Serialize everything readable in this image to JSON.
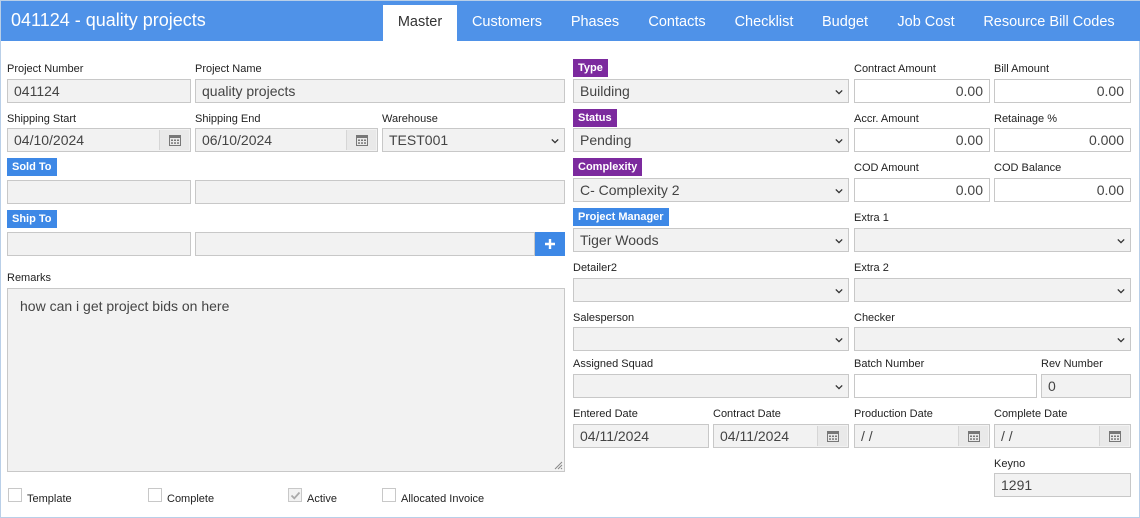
{
  "header": {
    "title": "041124 - quality projects"
  },
  "tabs": [
    "Master",
    "Customers",
    "Phases",
    "Contacts",
    "Checklist",
    "Budget",
    "Job Cost",
    "Resource Bill Codes"
  ],
  "labels": {
    "project_number": "Project Number",
    "project_name": "Project Name",
    "shipping_start": "Shipping Start",
    "shipping_end": "Shipping End",
    "warehouse": "Warehouse",
    "sold_to": "Sold To",
    "ship_to": "Ship To",
    "remarks": "Remarks",
    "type": "Type",
    "status": "Status",
    "complexity": "Complexity",
    "project_manager": "Project Manager",
    "detailer2": "Detailer2",
    "salesperson": "Salesperson",
    "assigned_squad": "Assigned Squad",
    "entered_date": "Entered Date",
    "contract_date": "Contract Date",
    "contract_amount": "Contract Amount",
    "bill_amount": "Bill Amount",
    "accr_amount": "Accr. Amount",
    "retainage": "Retainage %",
    "cod_amount": "COD Amount",
    "cod_balance": "COD Balance",
    "extra1": "Extra 1",
    "extra2": "Extra 2",
    "checker": "Checker",
    "batch_number": "Batch Number",
    "rev_number": "Rev Number",
    "production_date": "Production Date",
    "complete_date": "Complete Date",
    "keyno": "Keyno"
  },
  "values": {
    "project_number": "041124",
    "project_name": "quality projects",
    "shipping_start": "04/10/2024",
    "shipping_end": "06/10/2024",
    "warehouse": "TEST001",
    "sold_to_code": "",
    "sold_to_name": "",
    "ship_to_code": "",
    "ship_to_name": "",
    "remarks": "how can i get project bids on here",
    "type": "Building",
    "status": "Pending",
    "complexity": "C- Complexity 2",
    "project_manager": "Tiger Woods",
    "detailer2": "",
    "salesperson": "",
    "assigned_squad": "",
    "entered_date": "04/11/2024",
    "contract_date": "04/11/2024",
    "contract_amount": "0.00",
    "bill_amount": "0.00",
    "accr_amount": "0.00",
    "retainage": "0.000",
    "cod_amount": "0.00",
    "cod_balance": "0.00",
    "extra1": "",
    "extra2": "",
    "checker": "",
    "batch_number": "",
    "rev_number": "0",
    "production_date": " /  /",
    "complete_date": " /  /",
    "keyno": "1291"
  },
  "checkboxes": [
    {
      "label": "Template",
      "checked": false
    },
    {
      "label": "Complete",
      "checked": false
    },
    {
      "label": "Active",
      "checked": true
    },
    {
      "label": "Allocated Invoice",
      "checked": false
    }
  ],
  "icons": {
    "calendar": "calendar-icon",
    "dropdown": "chevron-down-icon",
    "add": "plus-icon"
  },
  "colors": {
    "header": "#4f92e8",
    "badge_purple": "#7c2a9e",
    "badge_blue": "#3d88e6"
  }
}
